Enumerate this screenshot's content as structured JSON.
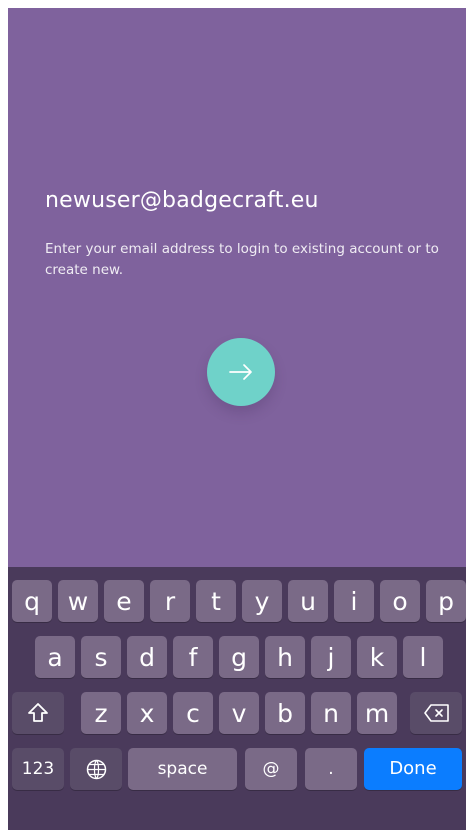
{
  "screen": {
    "background_color": "#7f629d",
    "accent_color": "#6fd2c9",
    "keyboard_color": "#4a3a5b",
    "done_key_color": "#0b7dff"
  },
  "login": {
    "email_value": "newuser@badgecraft.eu",
    "instruction_text": "Enter your email address to login to existing account or to create new.",
    "next_icon": "arrow-right-icon"
  },
  "keyboard": {
    "row1": [
      "q",
      "w",
      "e",
      "r",
      "t",
      "y",
      "u",
      "i",
      "o",
      "p"
    ],
    "row2": [
      "a",
      "s",
      "d",
      "f",
      "g",
      "h",
      "j",
      "k",
      "l"
    ],
    "row3": [
      "z",
      "x",
      "c",
      "v",
      "b",
      "n",
      "m"
    ],
    "shift_icon": "shift-icon",
    "delete_icon": "backspace-icon",
    "globe_icon": "globe-icon",
    "numbers_label": "123",
    "space_label": "space",
    "at_label": "@",
    "period_label": ".",
    "done_label": "Done"
  }
}
